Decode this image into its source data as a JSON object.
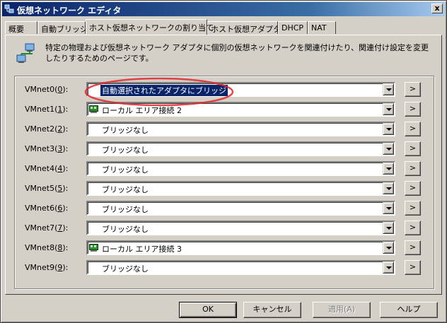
{
  "window": {
    "title": "仮想ネットワーク エディタ",
    "close_label": "x"
  },
  "tabs": [
    {
      "label": "概要",
      "active": false
    },
    {
      "label": "自動ブリッジ",
      "active": false
    },
    {
      "label": "ホスト仮想ネットワークの割り当て",
      "active": true
    },
    {
      "label": "ホスト仮想アダプタ",
      "active": false
    },
    {
      "label": "DHCP",
      "active": false
    },
    {
      "label": "NAT",
      "active": false
    }
  ],
  "description": "特定の物理および仮想ネットワーク アダプタに個別の仮想ネットワークを関連付けたり、関連付け設定を変更したりするためのページです。",
  "vmnets": [
    {
      "label": "VMnet0(",
      "key": "0",
      "close": "):",
      "value": "自動選択されたアダプタにブリッジ",
      "style": "sel"
    },
    {
      "label": "VMnet1(",
      "key": "1",
      "close": "):",
      "value": "ローカル エリア接続 2",
      "style": "nic"
    },
    {
      "label": "VMnet2(",
      "key": "2",
      "close": "):",
      "value": "ブリッジなし",
      "style": "plain"
    },
    {
      "label": "VMnet3(",
      "key": "3",
      "close": "):",
      "value": "ブリッジなし",
      "style": "plain"
    },
    {
      "label": "VMnet4(",
      "key": "4",
      "close": "):",
      "value": "ブリッジなし",
      "style": "plain"
    },
    {
      "label": "VMnet5(",
      "key": "5",
      "close": "):",
      "value": "ブリッジなし",
      "style": "plain"
    },
    {
      "label": "VMnet6(",
      "key": "6",
      "close": "):",
      "value": "ブリッジなし",
      "style": "plain"
    },
    {
      "label": "VMnet7(",
      "key": "7",
      "close": "):",
      "value": "ブリッジなし",
      "style": "plain"
    },
    {
      "label": "VMnet8(",
      "key": "8",
      "close": "):",
      "value": "ローカル エリア接続 3",
      "style": "nic"
    },
    {
      "label": "VMnet9(",
      "key": "9",
      "close": "):",
      "value": "ブリッジなし",
      "style": "plain"
    }
  ],
  "more_label": ">",
  "buttons": {
    "ok": "OK",
    "cancel": "キャンセル",
    "apply": "適用(A)",
    "help": "ヘルプ"
  },
  "colors": {
    "title_bar": "#0a246a",
    "selection": "#0a246a",
    "annotation": "#e0282e",
    "face": "#d4d0c8"
  }
}
